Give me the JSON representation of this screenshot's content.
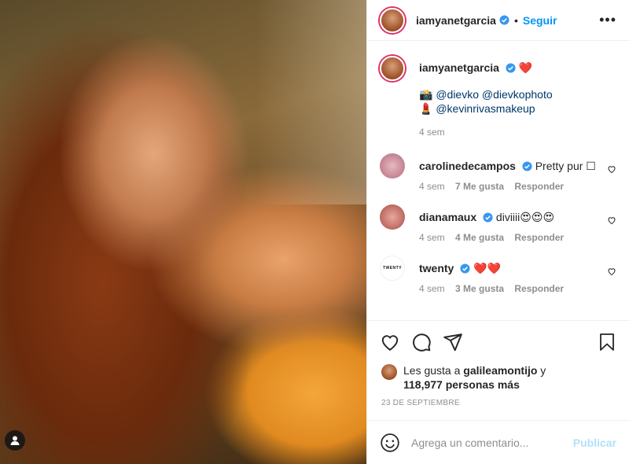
{
  "post": {
    "username": "iamyanetgarcia",
    "follow_label": "Seguir",
    "dot": "•",
    "more_label": "•••"
  },
  "caption": {
    "emoji_heart": "❤️",
    "line1_emoji": "📸",
    "line1_mentions": "@dievko @dievkophoto",
    "line2_emoji": "💄",
    "line2_mentions": "@kevinrivasmakeup",
    "time": "4 sem"
  },
  "comments": [
    {
      "username": "carolinedecampos",
      "text": "Pretty pur ☐",
      "time": "4 sem",
      "likes": "7 Me gusta",
      "reply": "Responder"
    },
    {
      "username": "dianamaux",
      "text": "diviiii😍😍😍",
      "time": "4 sem",
      "likes": "4 Me gusta",
      "reply": "Responder"
    },
    {
      "username": "twenty",
      "text": "❤️❤️",
      "time": "4 sem",
      "likes": "3 Me gusta",
      "reply": "Responder",
      "avatar_text": "TWENTY"
    }
  ],
  "likes": {
    "prefix": "Les gusta a",
    "user": "galileamontijo",
    "suffix": "y",
    "count": "118,977 personas más"
  },
  "date": "23 DE SEPTIEMBRE",
  "comment_box": {
    "placeholder": "Agrega un comentario...",
    "publish_label": "Publicar"
  },
  "icons": [
    "user-tag-icon",
    "verified-badge-icon",
    "heart-icon",
    "comment-icon",
    "share-icon",
    "save-icon",
    "emoji-icon"
  ],
  "colors": {
    "accent_blue": "#0095f6",
    "mention_blue": "#00376b",
    "muted": "#8e8e8e",
    "publish_disabled": "#b2dffc"
  }
}
